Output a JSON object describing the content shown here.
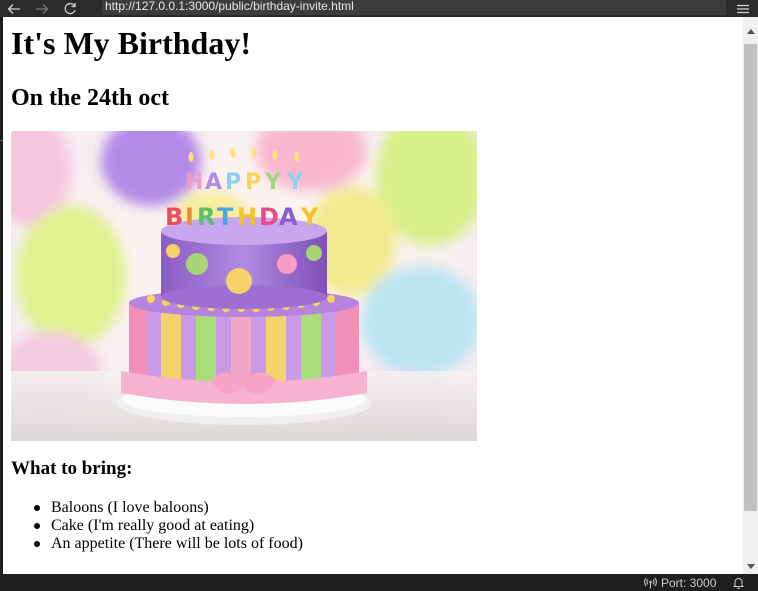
{
  "browser": {
    "url": "http://127.0.0.1:3000/public/birthday-invite.html",
    "back_icon": "arrow-left",
    "forward_icon": "arrow-right",
    "reload_icon": "reload",
    "menu_icon": "hamburger"
  },
  "page": {
    "title": "It's My Birthday!",
    "date": "On the 24th oct",
    "image_subject": "birthday cake with Happy Birthday candles and balloons",
    "bring_heading": "What to bring:",
    "items": [
      "Baloons (I love baloons)",
      "Cake (I'm really good at eating)",
      "An appetite (There will be lots of food)"
    ]
  },
  "statusbar": {
    "port_label": "Port: 3000",
    "port_icon": "broadcast",
    "bell_icon": "bell"
  },
  "colors": {
    "chrome_bg": "#1e1e1e",
    "url_bg": "#3c3c3c",
    "page_bg": "#ffffff",
    "scroll_thumb": "#c1c1c1"
  }
}
